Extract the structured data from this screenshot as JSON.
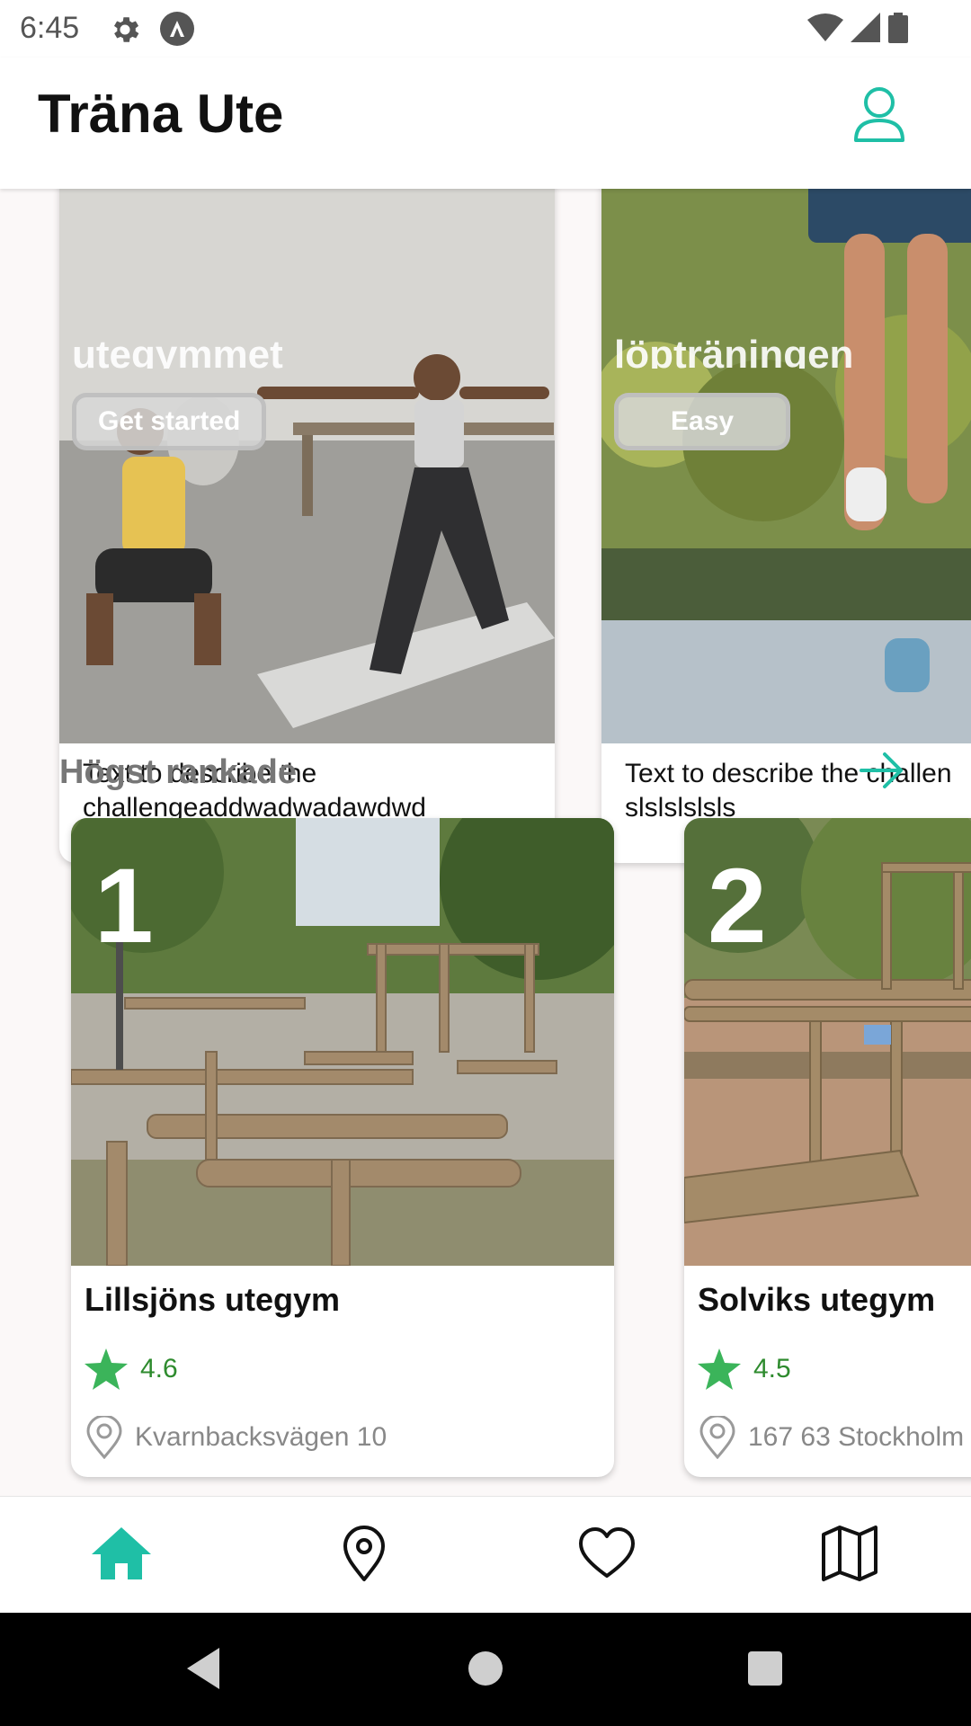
{
  "status_bar": {
    "time": "6:45",
    "icons": [
      "gear-icon",
      "app-logo-icon",
      "wifi-icon",
      "signal-icon",
      "battery-icon"
    ]
  },
  "app_bar": {
    "title": "Träna Ute",
    "profile_icon": "person-icon",
    "accent": "#1fbfa6"
  },
  "challenges": [
    {
      "cut_title": "utegymmet",
      "badge": "Get started",
      "description": "Text to describe the\nchallengeaddwadwadawdwd"
    },
    {
      "cut_title": "löpträningen",
      "badge": "Easy",
      "description": "Text to describe the challen\nslslslslsls"
    }
  ],
  "top_rated": {
    "title": "Högst rankade",
    "arrow_icon": "arrow-right-icon",
    "gyms": [
      {
        "rank": "1",
        "name": "Lillsjöns utegym",
        "rating": "4.6",
        "address": "Kvarnbacksvägen 10"
      },
      {
        "rank": "2",
        "name": "Solviks utegym",
        "rating": "4.5",
        "address": "167 63 Stockholm"
      }
    ]
  },
  "bottom_nav": {
    "items": [
      {
        "icon": "home-icon",
        "active": true
      },
      {
        "icon": "location-pin-icon",
        "active": false
      },
      {
        "icon": "heart-icon",
        "active": false
      },
      {
        "icon": "map-icon",
        "active": false
      }
    ]
  },
  "colors": {
    "accent": "#1fbfa6",
    "rating": "#2e8b2e",
    "star": "#3bb45a"
  }
}
